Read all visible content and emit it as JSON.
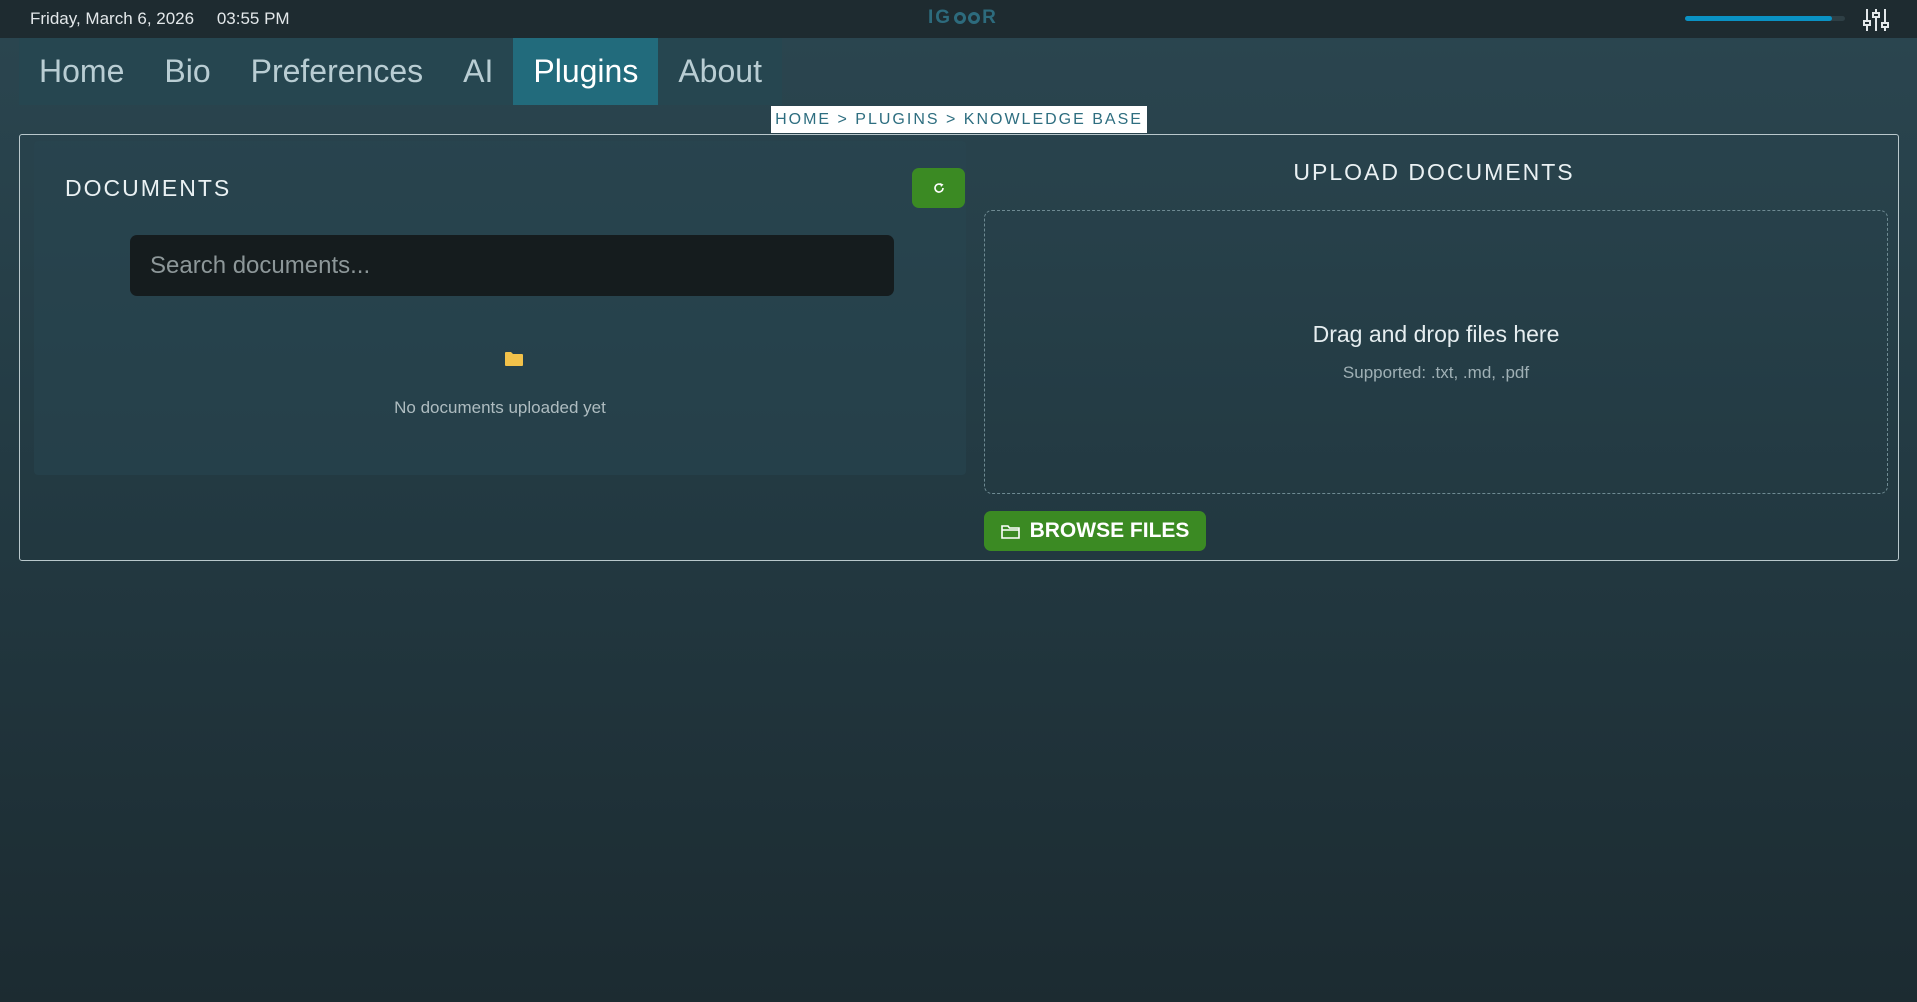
{
  "status_bar": {
    "date": "Friday, March 6, 2026",
    "time": "03:55 PM",
    "logo_text_left": "IG",
    "logo_text_right": "R",
    "volume_level": 0.92,
    "accent_color": "#0a92c4",
    "settings_icon": "sliders-icon"
  },
  "nav": {
    "tabs": [
      {
        "label": "Home",
        "active": false
      },
      {
        "label": "Bio",
        "active": false
      },
      {
        "label": "Preferences",
        "active": false
      },
      {
        "label": "AI",
        "active": false
      },
      {
        "label": "Plugins",
        "active": true
      },
      {
        "label": "About",
        "active": false
      }
    ]
  },
  "breadcrumb": "HOME > PLUGINS > KNOWLEDGE BASE",
  "documents": {
    "title": "DOCUMENTS",
    "refresh_icon": "refresh-icon",
    "search_placeholder": "Search documents...",
    "empty_icon": "folder-icon",
    "empty_text": "No documents uploaded yet"
  },
  "upload": {
    "title": "UPLOAD DOCUMENTS",
    "drop_title": "Drag and drop files here",
    "drop_subtitle": "Supported: .txt, .md, .pdf",
    "browse_label": "BROWSE FILES",
    "browse_icon": "folder-outline-icon",
    "button_color": "#3b8a23"
  }
}
